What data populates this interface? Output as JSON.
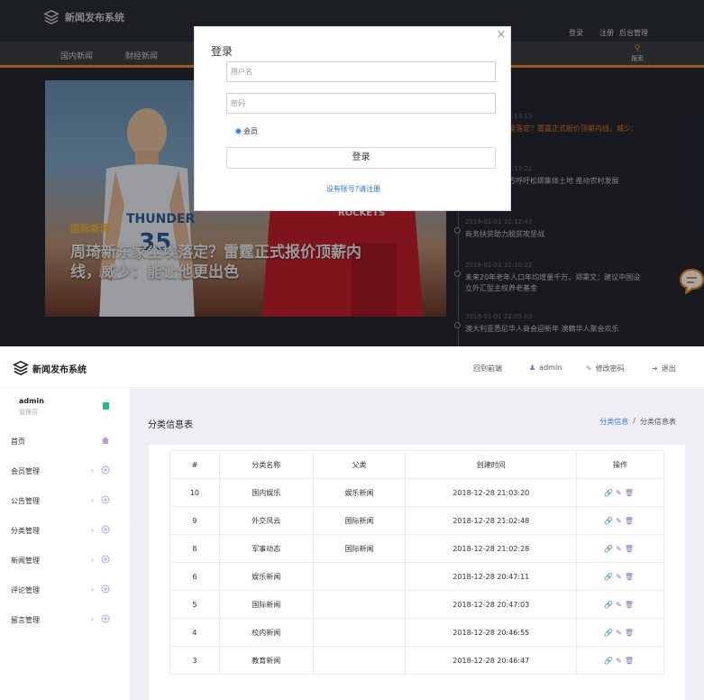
{
  "front": {
    "logo_text": "新闻发布系统",
    "top_links": [
      "登录",
      "注册",
      "后台管理"
    ],
    "nav_items": [
      "国内新闻",
      "财经新闻"
    ],
    "search_label": "搜索",
    "hero": {
      "tag": "国际新闻",
      "headline": "周琦新东家尘埃落定？雷霆正式报价顶薪内线，威少：能让他更出色"
    },
    "timeline": [
      {
        "date": "2019-01-01 22:13:15",
        "title": "周琦新东家尘埃落定？雷霆正式报价顶薪内线，威少：",
        "hot": true
      },
      {
        "date": "2019-01-01 22:13:21",
        "title": "商务呼吁：各方呼吁松绑集体土地 推动农村发展",
        "hot": false
      },
      {
        "date": "2019-01-01 22:12:43",
        "title": "商务扶贫助力脱贫攻坚战",
        "hot": false
      },
      {
        "date": "2019-01-01 22:10:22",
        "title": "未来20年老年人口年均增量千万，郑秉文：建议中国设立外汇型主权养老基金",
        "hot": false
      },
      {
        "date": "2019-01-01 22:05:03",
        "title": "澳大利亚悉尼华人商会迎新年 澳籍华人聚会欢乐",
        "hot": false
      }
    ]
  },
  "login_modal": {
    "title": "登录",
    "username_placeholder": "用户名",
    "password_placeholder": "密码",
    "role_option": "会员",
    "submit_label": "登录",
    "register_link": "没有账号?请注册"
  },
  "admin": {
    "brand": "新闻发布系统",
    "header_links": {
      "front": "回到前端",
      "user": "admin",
      "change_password": "修改密码",
      "logout": "退出"
    },
    "user": {
      "name": "admin",
      "role": "管理员"
    },
    "menu": [
      "首页",
      "会员管理",
      "公告管理",
      "分类管理",
      "新闻管理",
      "评论管理",
      "留言管理"
    ],
    "page_title": "分类信息表",
    "breadcrumb": {
      "parent": "分类信息",
      "current": "分类信息表"
    },
    "table": {
      "headers": [
        "#",
        "分类名称",
        "父类",
        "创建时间",
        "操作"
      ],
      "rows": [
        {
          "id": "10",
          "name": "国内娱乐",
          "parent": "娱乐新闻",
          "created": "2018-12-28 21:03:20"
        },
        {
          "id": "9",
          "name": "外交风云",
          "parent": "国际新闻",
          "created": "2018-12-28 21:02:48"
        },
        {
          "id": "8",
          "name": "军事动态",
          "parent": "国际新闻",
          "created": "2018-12-28 21:02:28"
        },
        {
          "id": "6",
          "name": "娱乐新闻",
          "parent": "",
          "created": "2018-12-28 20:47:11"
        },
        {
          "id": "5",
          "name": "国际新闻",
          "parent": "",
          "created": "2018-12-28 20:47:03"
        },
        {
          "id": "4",
          "name": "校内新闻",
          "parent": "",
          "created": "2018-12-28 20:46:55"
        },
        {
          "id": "3",
          "name": "教育新闻",
          "parent": "",
          "created": "2018-12-28 20:46:47"
        }
      ]
    },
    "accent_color": "#8d6cc7"
  }
}
